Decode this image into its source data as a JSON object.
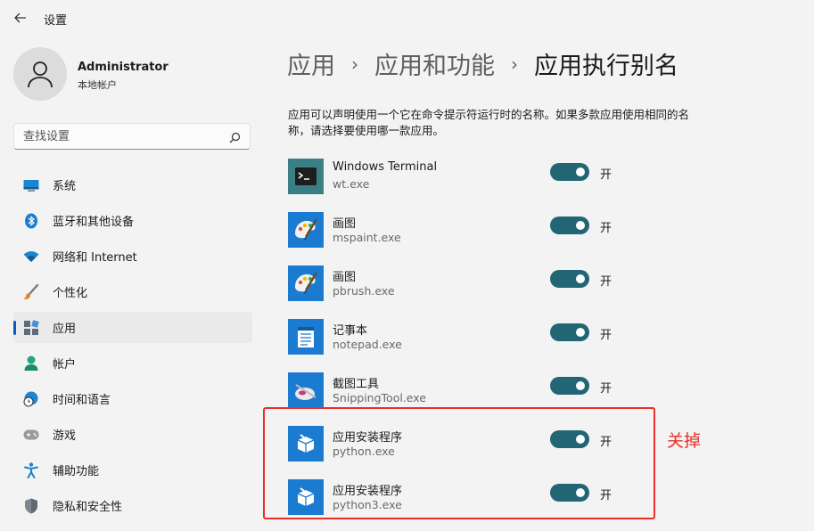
{
  "window": {
    "title": "设置"
  },
  "user": {
    "name": "Administrator",
    "account_type": "本地帐户"
  },
  "search": {
    "placeholder": "查找设置"
  },
  "nav": [
    {
      "label": "系统",
      "icon": "monitor-icon"
    },
    {
      "label": "蓝牙和其他设备",
      "icon": "bluetooth-icon"
    },
    {
      "label": "网络和 Internet",
      "icon": "wifi-icon"
    },
    {
      "label": "个性化",
      "icon": "brush-icon"
    },
    {
      "label": "应用",
      "icon": "apps-icon",
      "active": true
    },
    {
      "label": "帐户",
      "icon": "person-icon"
    },
    {
      "label": "时间和语言",
      "icon": "globe-clock-icon"
    },
    {
      "label": "游戏",
      "icon": "gamepad-icon"
    },
    {
      "label": "辅助功能",
      "icon": "accessibility-icon"
    },
    {
      "label": "隐私和安全性",
      "icon": "shield-icon"
    }
  ],
  "breadcrumb": {
    "level1": "应用",
    "level2": "应用和功能",
    "current": "应用执行别名",
    "separator": "›"
  },
  "description": "应用可以声明使用一个它在命令提示符运行时的名称。如果多款应用使用相同的名称，请选择要使用哪一款应用。",
  "aliases": [
    {
      "name": "Windows Terminal",
      "exe": "wt.exe",
      "state": "开",
      "on": true,
      "icon": "terminal-icon"
    },
    {
      "name": "画图",
      "exe": "mspaint.exe",
      "state": "开",
      "on": true,
      "icon": "paint-icon"
    },
    {
      "name": "画图",
      "exe": "pbrush.exe",
      "state": "开",
      "on": true,
      "icon": "paint-icon"
    },
    {
      "name": "记事本",
      "exe": "notepad.exe",
      "state": "开",
      "on": true,
      "icon": "notepad-icon"
    },
    {
      "name": "截图工具",
      "exe": "SnippingTool.exe",
      "state": "开",
      "on": true,
      "icon": "snipping-tool-icon"
    },
    {
      "name": "应用安装程序",
      "exe": "python.exe",
      "state": "开",
      "on": true,
      "icon": "app-installer-icon"
    },
    {
      "name": "应用安装程序",
      "exe": "python3.exe",
      "state": "开",
      "on": true,
      "icon": "app-installer-icon"
    }
  ],
  "annotation": {
    "text": "关掉",
    "color": "#e8302a"
  },
  "colors": {
    "toggle_on": "#226574",
    "accent": "#005fb8",
    "annotation": "#e8302a"
  }
}
